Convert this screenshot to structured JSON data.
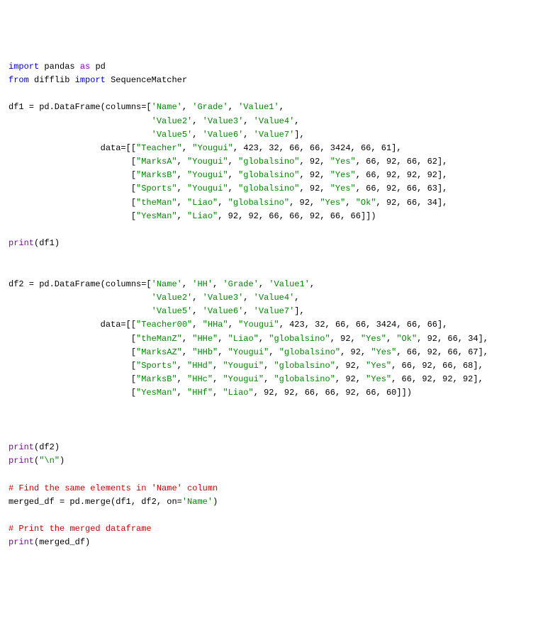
{
  "line_01_import": "import",
  "line_01_pandas": "pandas",
  "line_01_as": "as",
  "line_01_pd": "pd",
  "line_02_from": "from",
  "line_02_difflib": "difflib",
  "line_02_import": "import",
  "line_02_seq": "SequenceMatcher",
  "line_04a": "df1 = pd.DataFrame(columns=[",
  "s_name": "'Name'",
  "s_grade": "'Grade'",
  "s_v1": "'Value1'",
  "s_v2": "'Value2'",
  "s_v3": "'Value3'",
  "s_v4": "'Value4'",
  "s_v5": "'Value5'",
  "s_v6": "'Value6'",
  "s_v7": "'Value7'",
  "s_HH": "'HH'",
  "data_eq": "data=[[",
  "teacher": "\"Teacher\"",
  "yougui": "\"Yougui\"",
  "marksa": "\"MarksA\"",
  "globalsino": "\"globalsino\"",
  "yes": "\"Yes\"",
  "marksb": "\"MarksB\"",
  "sports": "\"Sports\"",
  "theman": "\"theMan\"",
  "liao": "\"Liao\"",
  "ok": "\"Ok\"",
  "yesman": "\"YesMan\"",
  "teacher00": "\"Teacher00\"",
  "hha": "\"HHa\"",
  "themanz": "\"theManZ\"",
  "hhe": "\"HHe\"",
  "marksaz": "\"MarksAZ\"",
  "hhb": "\"HHb\"",
  "hhd": "\"HHd\"",
  "hhc": "\"HHc\"",
  "hhf": "\"HHf\"",
  "n423": "423",
  "n32": "32",
  "n66": "66",
  "n3424": "3424",
  "n61": "61",
  "n92": "92",
  "n62": "62",
  "n63": "63",
  "n34": "34",
  "n67": "67",
  "n68": "68",
  "n60": "60",
  "print": "print",
  "df1_var": "df1",
  "df2_var": "df2",
  "df2_assign": "df2 = pd.DataFrame(columns=[",
  "newline_str": "\"\\n\"",
  "comment1": "# Find the same elements in 'Name' column",
  "merge_line_a": "merged_df = pd.merge(df1, df2, on=",
  "merge_on": "'Name'",
  "comment2": "# Print the merged dataframe",
  "merged_df": "merged_df"
}
